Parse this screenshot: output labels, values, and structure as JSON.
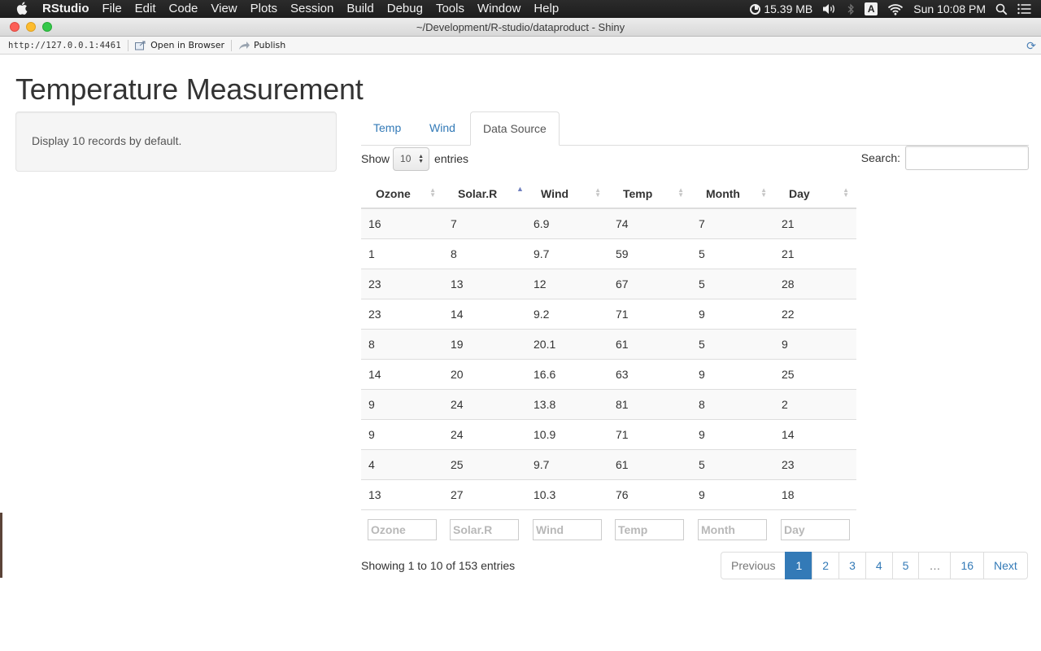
{
  "menubar": {
    "items": [
      "RStudio",
      "File",
      "Edit",
      "Code",
      "View",
      "Plots",
      "Session",
      "Build",
      "Debug",
      "Tools",
      "Window",
      "Help"
    ],
    "memory": "15.39 MB",
    "keyboard_badge": "A",
    "clock": "Sun 10:08 PM",
    "status_icons": [
      "memory-icon",
      "volume-icon",
      "bluetooth-icon",
      "input-source-icon",
      "wifi-icon",
      "spotlight-icon",
      "notification-center-icon"
    ]
  },
  "window": {
    "title": "~/Development/R-studio/dataproduct - Shiny",
    "url": "http://127.0.0.1:4461",
    "open_in_browser": "Open in Browser",
    "publish": "Publish"
  },
  "page": {
    "title": "Temperature Measurement",
    "sidebar_text": "Display 10 records by default.",
    "tabs": [
      "Temp",
      "Wind",
      "Data Source"
    ],
    "active_tab": "Data Source"
  },
  "datatable": {
    "length_label_before": "Show",
    "length_value": "10",
    "length_label_after": "entries",
    "search_label": "Search:",
    "search_value": "",
    "sorted_column": "Solar.R",
    "columns": [
      "Ozone",
      "Solar.R",
      "Wind",
      "Temp",
      "Month",
      "Day"
    ],
    "rows": [
      [
        "16",
        "7",
        "6.9",
        "74",
        "7",
        "21"
      ],
      [
        "1",
        "8",
        "9.7",
        "59",
        "5",
        "21"
      ],
      [
        "23",
        "13",
        "12",
        "67",
        "5",
        "28"
      ],
      [
        "23",
        "14",
        "9.2",
        "71",
        "9",
        "22"
      ],
      [
        "8",
        "19",
        "20.1",
        "61",
        "5",
        "9"
      ],
      [
        "14",
        "20",
        "16.6",
        "63",
        "9",
        "25"
      ],
      [
        "9",
        "24",
        "13.8",
        "81",
        "8",
        "2"
      ],
      [
        "9",
        "24",
        "10.9",
        "71",
        "9",
        "14"
      ],
      [
        "4",
        "25",
        "9.7",
        "61",
        "5",
        "23"
      ],
      [
        "13",
        "27",
        "10.3",
        "76",
        "9",
        "18"
      ]
    ],
    "filter_placeholders": [
      "Ozone",
      "Solar.R",
      "Wind",
      "Temp",
      "Month",
      "Day"
    ],
    "info": "Showing 1 to 10 of 153 entries",
    "pagination": {
      "previous": "Previous",
      "pages": [
        "1",
        "2",
        "3",
        "4",
        "5",
        "…",
        "16"
      ],
      "current": "1",
      "next": "Next"
    }
  }
}
